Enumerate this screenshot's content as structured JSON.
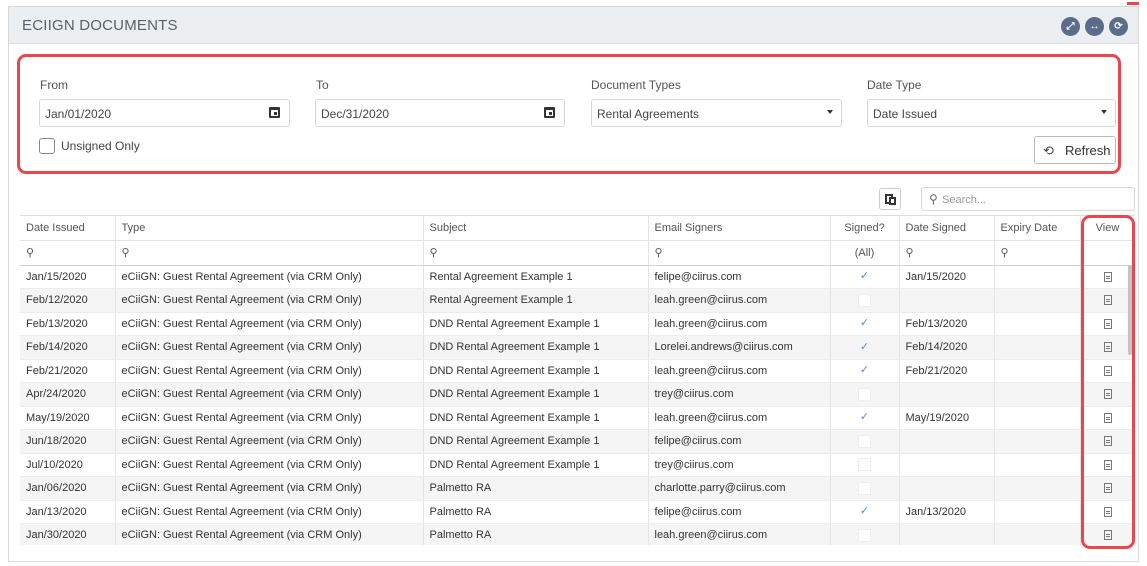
{
  "header": {
    "title": "ECIIGN DOCUMENTS"
  },
  "filters": {
    "from_label": "From",
    "from_value": "Jan/01/2020",
    "to_label": "To",
    "to_value": "Dec/31/2020",
    "doc_types_label": "Document Types",
    "doc_types_value": "Rental Agreements",
    "date_type_label": "Date Type",
    "date_type_value": "Date Issued",
    "unsigned_only_label": "Unsigned Only",
    "refresh_label": "Refresh"
  },
  "toolbar": {
    "search_placeholder": "Search..."
  },
  "table": {
    "columns": [
      "Date Issued",
      "Type",
      "Subject",
      "Email Signers",
      "Signed?",
      "Date Signed",
      "Expiry Date",
      "View"
    ],
    "signed_filter": "(All)",
    "rows": [
      {
        "date_issued": "Jan/15/2020",
        "type": "eCiiGN: Guest Rental Agreement (via CRM Only)",
        "subject": "Rental Agreement Example 1",
        "email": "felipe@ciirus.com",
        "signed": true,
        "date_signed": "Jan/15/2020",
        "expiry": ""
      },
      {
        "date_issued": "Feb/12/2020",
        "type": "eCiiGN: Guest Rental Agreement (via CRM Only)",
        "subject": "Rental Agreement Example 1",
        "email": "leah.green@ciirus.com",
        "signed": false,
        "date_signed": "",
        "expiry": ""
      },
      {
        "date_issued": "Feb/13/2020",
        "type": "eCiiGN: Guest Rental Agreement (via CRM Only)",
        "subject": "DND Rental Agreement Example 1",
        "email": "leah.green@ciirus.com",
        "signed": true,
        "date_signed": "Feb/13/2020",
        "expiry": ""
      },
      {
        "date_issued": "Feb/14/2020",
        "type": "eCiiGN: Guest Rental Agreement (via CRM Only)",
        "subject": "DND Rental Agreement Example 1",
        "email": "Lorelei.andrews@ciirus.com",
        "signed": true,
        "date_signed": "Feb/14/2020",
        "expiry": ""
      },
      {
        "date_issued": "Feb/21/2020",
        "type": "eCiiGN: Guest Rental Agreement (via CRM Only)",
        "subject": "DND Rental Agreement Example 1",
        "email": "leah.green@ciirus.com",
        "signed": true,
        "date_signed": "Feb/21/2020",
        "expiry": ""
      },
      {
        "date_issued": "Apr/24/2020",
        "type": "eCiiGN: Guest Rental Agreement (via CRM Only)",
        "subject": "DND Rental Agreement Example 1",
        "email": "trey@ciirus.com",
        "signed": false,
        "date_signed": "",
        "expiry": ""
      },
      {
        "date_issued": "May/19/2020",
        "type": "eCiiGN: Guest Rental Agreement (via CRM Only)",
        "subject": "DND Rental Agreement Example 1",
        "email": "leah.green@ciirus.com",
        "signed": true,
        "date_signed": "May/19/2020",
        "expiry": ""
      },
      {
        "date_issued": "Jun/18/2020",
        "type": "eCiiGN: Guest Rental Agreement (via CRM Only)",
        "subject": "DND Rental Agreement Example 1",
        "email": "felipe@ciirus.com",
        "signed": false,
        "date_signed": "",
        "expiry": ""
      },
      {
        "date_issued": "Jul/10/2020",
        "type": "eCiiGN: Guest Rental Agreement (via CRM Only)",
        "subject": "DND Rental Agreement Example 1",
        "email": "trey@ciirus.com",
        "signed": false,
        "date_signed": "",
        "expiry": ""
      },
      {
        "date_issued": "Jan/06/2020",
        "type": "eCiiGN: Guest Rental Agreement (via CRM Only)",
        "subject": "Palmetto RA",
        "email": "charlotte.parry@ciirus.com",
        "signed": false,
        "date_signed": "",
        "expiry": ""
      },
      {
        "date_issued": "Jan/13/2020",
        "type": "eCiiGN: Guest Rental Agreement (via CRM Only)",
        "subject": "Palmetto RA",
        "email": "felipe@ciirus.com",
        "signed": true,
        "date_signed": "Jan/13/2020",
        "expiry": ""
      },
      {
        "date_issued": "Jan/30/2020",
        "type": "eCiiGN: Guest Rental Agreement (via CRM Only)",
        "subject": "Palmetto RA",
        "email": "leah.green@ciirus.com",
        "signed": false,
        "date_signed": "",
        "expiry": ""
      }
    ]
  },
  "icons": {
    "header": [
      "expand-icon",
      "arrows-horizontal-icon",
      "refresh-circle-icon"
    ],
    "field": [
      "calendar-icon",
      "chevron-down-icon"
    ],
    "table": [
      "search-icon",
      "checkmark-icon",
      "document-icon"
    ]
  },
  "colors": {
    "highlight": "#e8474f",
    "header_button": "#5a6e8c",
    "check": "#4a90d9",
    "header_bg": "#eceff2"
  }
}
